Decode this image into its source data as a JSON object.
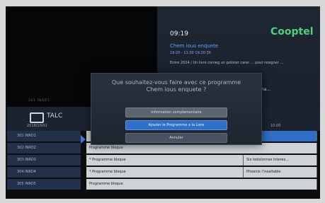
{
  "header": {
    "clock": "09:19",
    "brand": "Cooptel"
  },
  "current_program": {
    "title": "Chem ious enquete",
    "time": "19:20 - 11:00 19:20:30",
    "description": "Entre 2024 / Un livre comeg un polisier carer ... pour resigner ...",
    "extra": "nettiltalaha..."
  },
  "video": {
    "strip": "301  INRD1"
  },
  "channel_bar": {
    "name": "TALC",
    "date": "2018/10/01",
    "time_marker": "10:00"
  },
  "modal": {
    "question_line1": "Que souhaitez-vous faire avec ce programme",
    "question_line2": "Chem ious enquete ?",
    "btn_info": "Information complementaire",
    "btn_add": "Ajouter le Programme a la Liste",
    "btn_cancel": "Annuler"
  },
  "channels": [
    "301 INRD1",
    "302 INRD2",
    "303 INRD3",
    "304 INRD4",
    "305 INRD5"
  ],
  "guide": [
    {
      "cells": [
        {
          "label": "",
          "style": "gray"
        },
        {
          "label": "...dia",
          "style": "blue"
        }
      ]
    },
    {
      "cells": [
        {
          "label": "Programme bloque",
          "style": "gray"
        }
      ]
    },
    {
      "cells": [
        {
          "label": "* Programme bloque",
          "style": "gray"
        },
        {
          "label": "Six tedsionnes interes...",
          "style": "gray"
        }
      ]
    },
    {
      "cells": [
        {
          "label": "* Programme bloque",
          "style": "gray"
        },
        {
          "label": "Phoenix l'insaltable",
          "style": "gray"
        }
      ]
    },
    {
      "cells": [
        {
          "label": "Programme bloque",
          "style": "gray"
        }
      ]
    }
  ],
  "colors": {
    "accent_blue": "#2f6fc8",
    "brand_green": "#4fd07a",
    "title_blue": "#58a6ff"
  }
}
